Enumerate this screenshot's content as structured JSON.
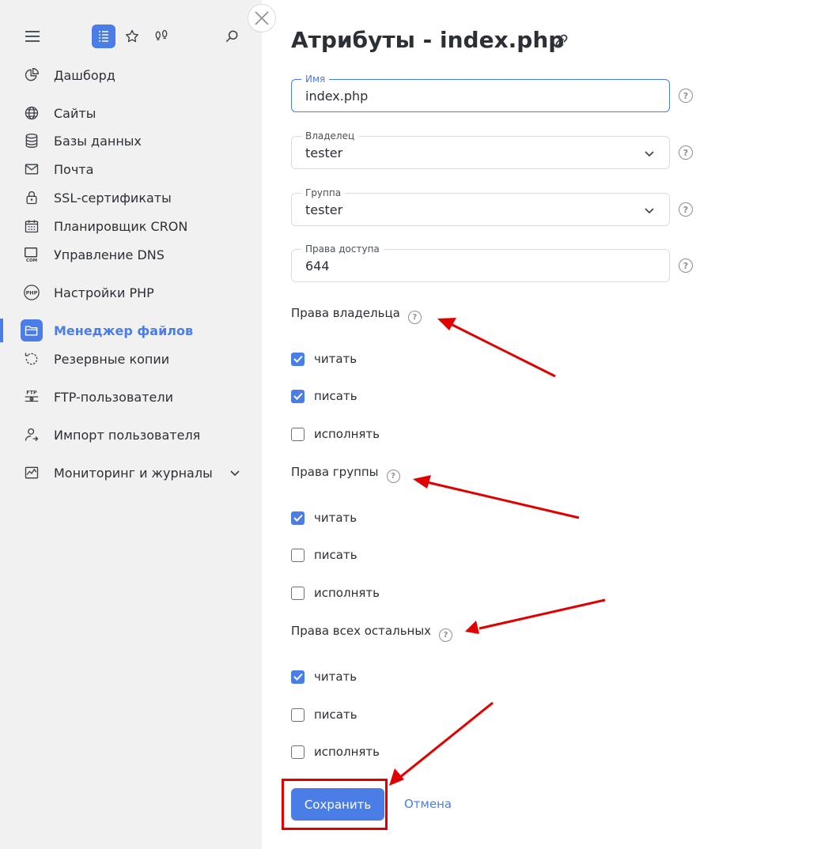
{
  "sidebar": {
    "top_icons": [
      "menu-icon",
      "list-icon",
      "star-icon",
      "footprints-icon",
      "search-icon"
    ],
    "items": [
      {
        "label": "Дашборд",
        "icon": "chart-pie-icon"
      },
      {
        "label": "Сайты",
        "icon": "globe-icon"
      },
      {
        "label": "Базы данных",
        "icon": "database-icon"
      },
      {
        "label": "Почта",
        "icon": "mail-icon"
      },
      {
        "label": "SSL-сертификаты",
        "icon": "lock-icon"
      },
      {
        "label": "Планировщик CRON",
        "icon": "calendar-icon"
      },
      {
        "label": "Управление DNS",
        "icon": "dns-com-icon"
      },
      {
        "label": "Настройки PHP",
        "icon": "php-icon"
      },
      {
        "label": "Менеджер файлов",
        "icon": "folder-icon",
        "active": true
      },
      {
        "label": "Резервные копии",
        "icon": "backup-icon"
      },
      {
        "label": "FTP-пользователи",
        "icon": "ftp-icon"
      },
      {
        "label": "Импорт пользователя",
        "icon": "user-import-icon"
      },
      {
        "label": "Мониторинг и журналы",
        "icon": "monitoring-icon",
        "expandable": true
      }
    ]
  },
  "main": {
    "title": "Атрибуты - index.php",
    "fields": {
      "name": {
        "label": "Имя",
        "value": "index.php"
      },
      "owner": {
        "label": "Владелец",
        "value": "tester"
      },
      "group": {
        "label": "Группа",
        "value": "tester"
      },
      "perms": {
        "label": "Права доступа",
        "value": "644"
      }
    },
    "sections": [
      {
        "title": "Права владельца",
        "options": [
          {
            "label": "читать",
            "checked": true
          },
          {
            "label": "писать",
            "checked": true
          },
          {
            "label": "исполнять",
            "checked": false
          }
        ]
      },
      {
        "title": "Права группы",
        "options": [
          {
            "label": "читать",
            "checked": true
          },
          {
            "label": "писать",
            "checked": false
          },
          {
            "label": "исполнять",
            "checked": false
          }
        ]
      },
      {
        "title": "Права всех остальных",
        "options": [
          {
            "label": "читать",
            "checked": true
          },
          {
            "label": "писать",
            "checked": false
          },
          {
            "label": "исполнять",
            "checked": false
          }
        ]
      }
    ],
    "save_label": "Сохранить",
    "cancel_label": "Отмена",
    "help_glyph": "?"
  },
  "colors": {
    "accent": "#4a7de6",
    "annotation": "#e00000",
    "sidebar_bg": "#f1f1f1"
  }
}
